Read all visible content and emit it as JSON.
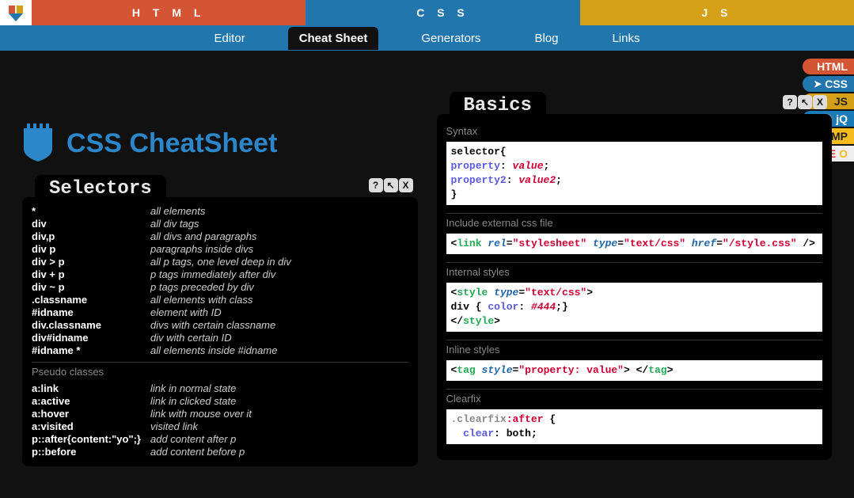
{
  "topnav": {
    "html": "H T M L",
    "css": "C S S",
    "js": "J S"
  },
  "subnav": {
    "editor": "Editor",
    "cheat": "Cheat Sheet",
    "generators": "Generators",
    "blog": "Blog",
    "links": "Links"
  },
  "title": "CSS CheatSheet",
  "badges": {
    "html": "HTML",
    "css": "CSS",
    "js": "JS",
    "jq": "jQ",
    "amp": "AMP"
  },
  "card_selectors": {
    "title": "Selectors",
    "rows": [
      {
        "c": "*",
        "d": "all elements"
      },
      {
        "c": "div",
        "d": "all div tags"
      },
      {
        "c": "div,p",
        "d": "all divs and paragraphs"
      },
      {
        "c": "div p",
        "d": "paragraphs inside divs"
      },
      {
        "c": "div > p",
        "d": "all p tags, one level deep in div"
      },
      {
        "c": "div + p",
        "d": "p tags immediately after div"
      },
      {
        "c": "div ~ p",
        "d": "p tags preceded by div"
      },
      {
        "c": ".classname",
        "d": "all elements with class"
      },
      {
        "c": "#idname",
        "d": "element with ID"
      },
      {
        "c": "div.classname",
        "d": "divs with certain classname"
      },
      {
        "c": "div#idname",
        "d": "div with certain ID"
      },
      {
        "c": "#idname *",
        "d": "all elements inside #idname"
      }
    ],
    "pseudo_label": "Pseudo classes",
    "pseudo": [
      {
        "c": "a:link",
        "d": "link in normal state"
      },
      {
        "c": "a:active",
        "d": "link in clicked state"
      },
      {
        "c": "a:hover",
        "d": "link with mouse over it"
      },
      {
        "c": "a:visited",
        "d": "visited link"
      },
      {
        "c": "p::after{content:\"yo\";}",
        "d": "add content after p"
      },
      {
        "c": "p::before",
        "d": "add content before p"
      }
    ]
  },
  "card_basics": {
    "title": "Basics",
    "syntax_label": "Syntax",
    "external_label": "Include external css file",
    "internal_label": "Internal styles",
    "inline_label": "Inline styles",
    "clearfix_label": "Clearfix"
  },
  "controls": {
    "help": "?",
    "expand": "↖",
    "close": "X"
  }
}
